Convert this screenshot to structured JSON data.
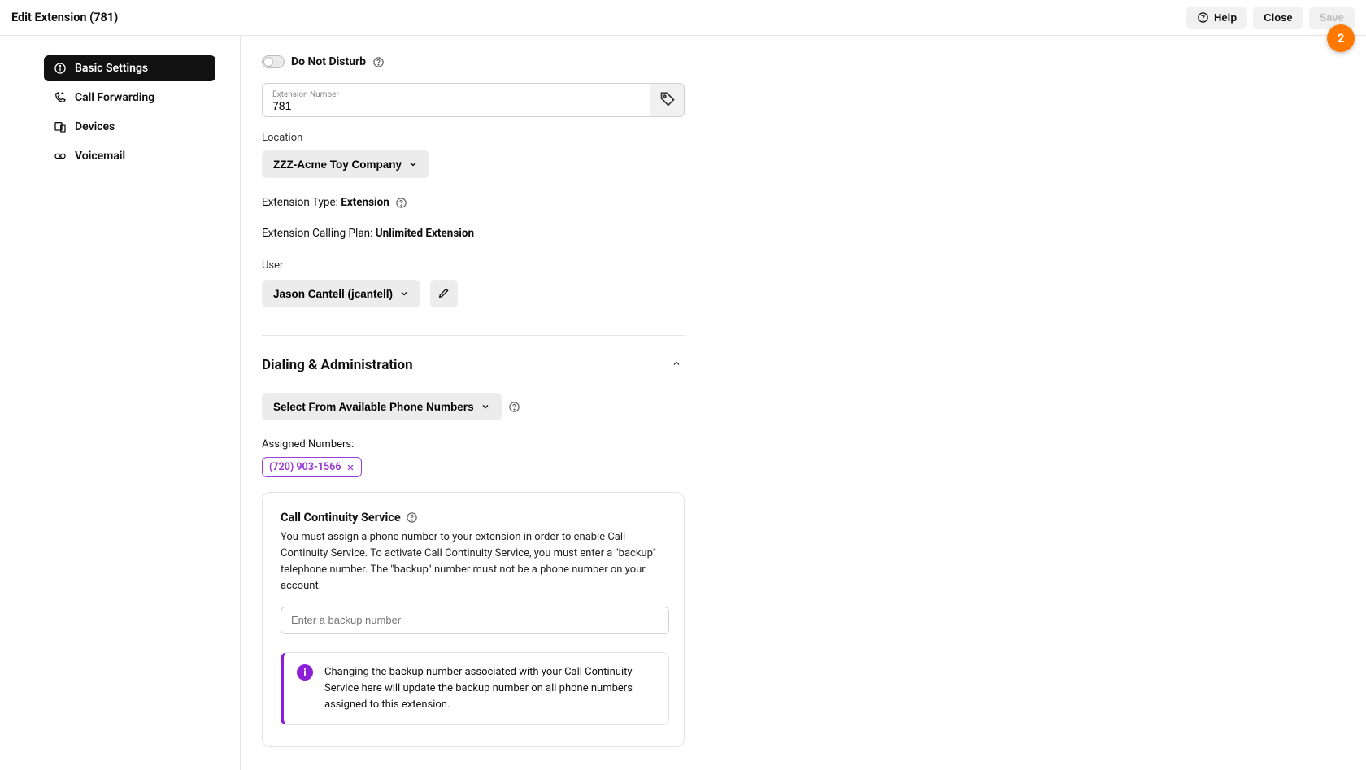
{
  "header": {
    "title": "Edit Extension (781)",
    "help_label": "Help",
    "close_label": "Close",
    "save_label": "Save",
    "fab_badge": "2"
  },
  "sidebar": {
    "items": [
      {
        "label": "Basic Settings",
        "active": true
      },
      {
        "label": "Call Forwarding",
        "active": false
      },
      {
        "label": "Devices",
        "active": false
      },
      {
        "label": "Voicemail",
        "active": false
      }
    ]
  },
  "basic": {
    "dnd_label": "Do Not Disturb",
    "ext_number_label": "Extension Number",
    "ext_number_value": "781",
    "location_label": "Location",
    "location_value": "ZZZ-Acme Toy Company",
    "ext_type_label": "Extension Type: ",
    "ext_type_value": "Extension",
    "plan_label": "Extension Calling Plan: ",
    "plan_value": "Unlimited Extension",
    "user_label": "User",
    "user_value": "Jason Cantell (jcantell)"
  },
  "dialing": {
    "heading": "Dialing & Administration",
    "select_btn": "Select From Available Phone Numbers",
    "assigned_label": "Assigned Numbers:",
    "assigned_chip": "(720) 903-1566",
    "ccs": {
      "title": "Call Continuity Service",
      "body": "You must assign a phone number to your extension in order to enable Call Continuity Service. To activate Call Continuity Service, you must enter a \"backup\" telephone number. The \"backup\" number must not be a phone number on your account.",
      "placeholder": "Enter a backup number",
      "alert": "Changing the backup number associated with your Call Continuity Service here will update the backup number on all phone numbers assigned to this extension."
    }
  }
}
